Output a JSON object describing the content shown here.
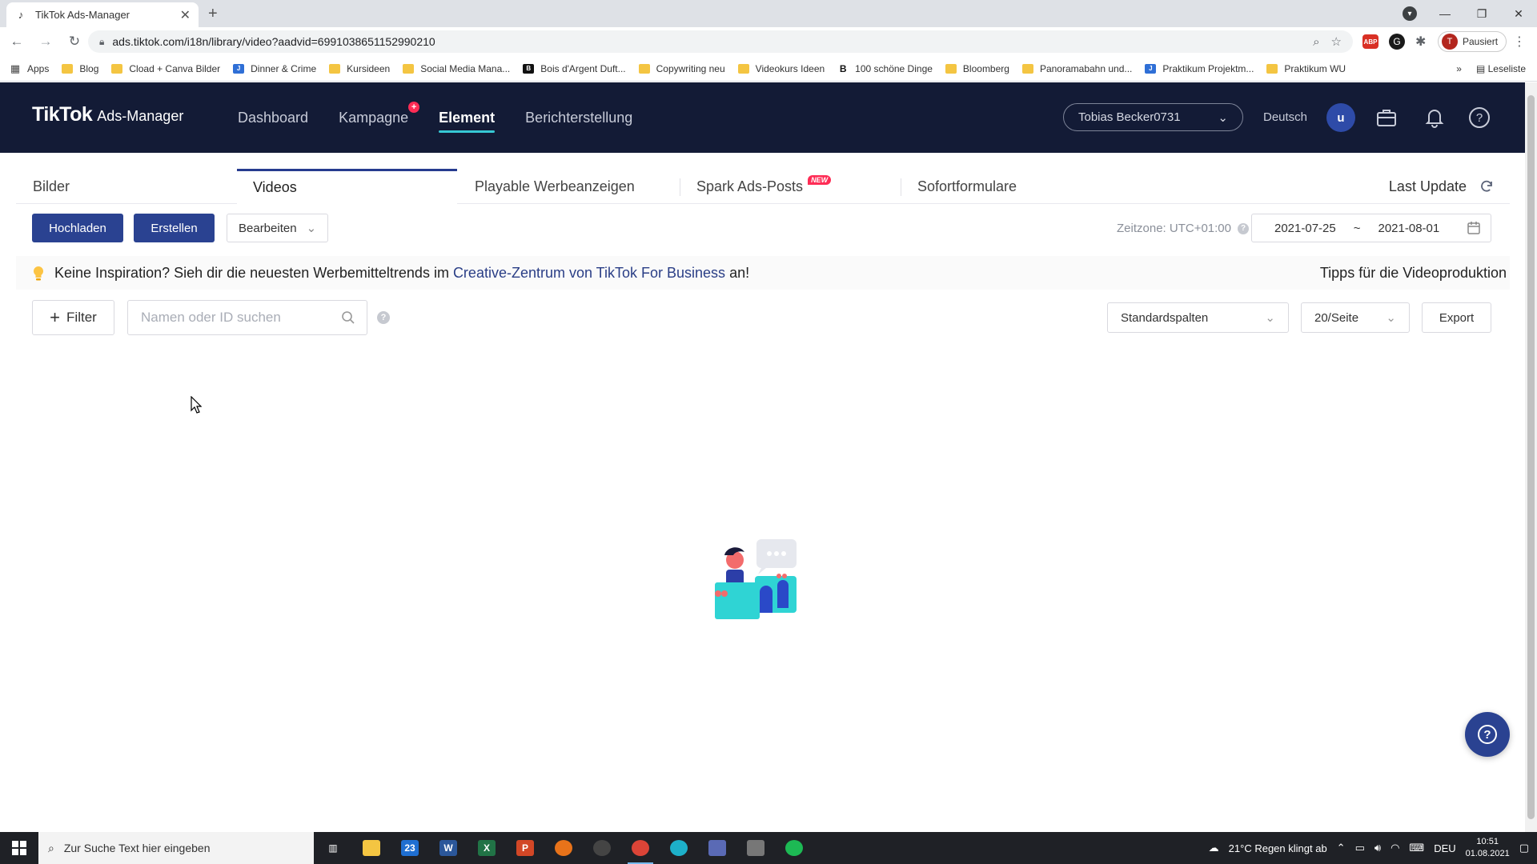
{
  "browser": {
    "tab_title": "TikTok Ads-Manager",
    "url": "ads.tiktok.com/i18n/library/video?aadvid=6991038651152990210",
    "profile_status": "Pausiert",
    "profile_initial": "T",
    "abp_label": "ABP",
    "ext_g_label": "G",
    "bookmarks": [
      {
        "label": "Apps",
        "icon": "grid-icon"
      },
      {
        "label": "Blog",
        "icon": "folder-icon"
      },
      {
        "label": "Cload + Canva Bilder",
        "icon": "folder-icon"
      },
      {
        "label": "Dinner & Crime",
        "icon": "jimdo-icon"
      },
      {
        "label": "Kursideen",
        "icon": "folder-icon"
      },
      {
        "label": "Social Media Mana...",
        "icon": "folder-icon"
      },
      {
        "label": "Bois d'Argent Duft...",
        "icon": "dark-icon"
      },
      {
        "label": "Copywriting neu",
        "icon": "folder-icon"
      },
      {
        "label": "Videokurs Ideen",
        "icon": "folder-icon"
      },
      {
        "label": "100 schöne Dinge",
        "icon": "b-icon"
      },
      {
        "label": "Bloomberg",
        "icon": "folder-icon"
      },
      {
        "label": "Panoramabahn und...",
        "icon": "folder-icon"
      },
      {
        "label": "Praktikum Projektm...",
        "icon": "j-icon"
      },
      {
        "label": "Praktikum WU",
        "icon": "folder-icon"
      }
    ],
    "reading_list": "Leseliste",
    "more_bookmarks": "»"
  },
  "header": {
    "logo_main": "TikTok",
    "logo_sub": "Ads-Manager",
    "nav": [
      {
        "label": "Dashboard"
      },
      {
        "label": "Kampagne"
      },
      {
        "label": "Element"
      },
      {
        "label": "Berichterstellung"
      }
    ],
    "account_name": "Tobias Becker0731",
    "language": "Deutsch",
    "avatar_initial": "u"
  },
  "content_tabs": {
    "items": [
      {
        "label": "Bilder"
      },
      {
        "label": "Videos"
      },
      {
        "label": "Playable Werbeanzeigen"
      },
      {
        "label": "Spark Ads-Posts"
      },
      {
        "label": "Sofortformulare"
      }
    ],
    "new_badge": "NEW",
    "last_update": "Last Update"
  },
  "actions": {
    "upload": "Hochladen",
    "create": "Erstellen",
    "edit": "Bearbeiten",
    "timezone": "Zeitzone: UTC+01:00",
    "date_start": "2021-07-25",
    "date_sep": "~",
    "date_end": "2021-08-01"
  },
  "banner": {
    "text_prefix": "Keine Inspiration? Sieh dir die neuesten Werbemitteltrends im ",
    "link": "Creative-Zentrum von TikTok For Business",
    "text_suffix": " an!",
    "tips_link": "Tipps für die Videoproduktion"
  },
  "filters": {
    "filter_label": "Filter",
    "search_placeholder": "Namen oder ID suchen",
    "columns_select": "Standardspalten",
    "page_size": "20/Seite",
    "export": "Export"
  },
  "taskbar": {
    "search_placeholder": "Zur Suche Text hier eingeben",
    "mail_badge": "23",
    "weather": "21°C  Regen klingt ab",
    "input_lang": "DEU",
    "time": "10:51",
    "date": "01.08.2021"
  }
}
